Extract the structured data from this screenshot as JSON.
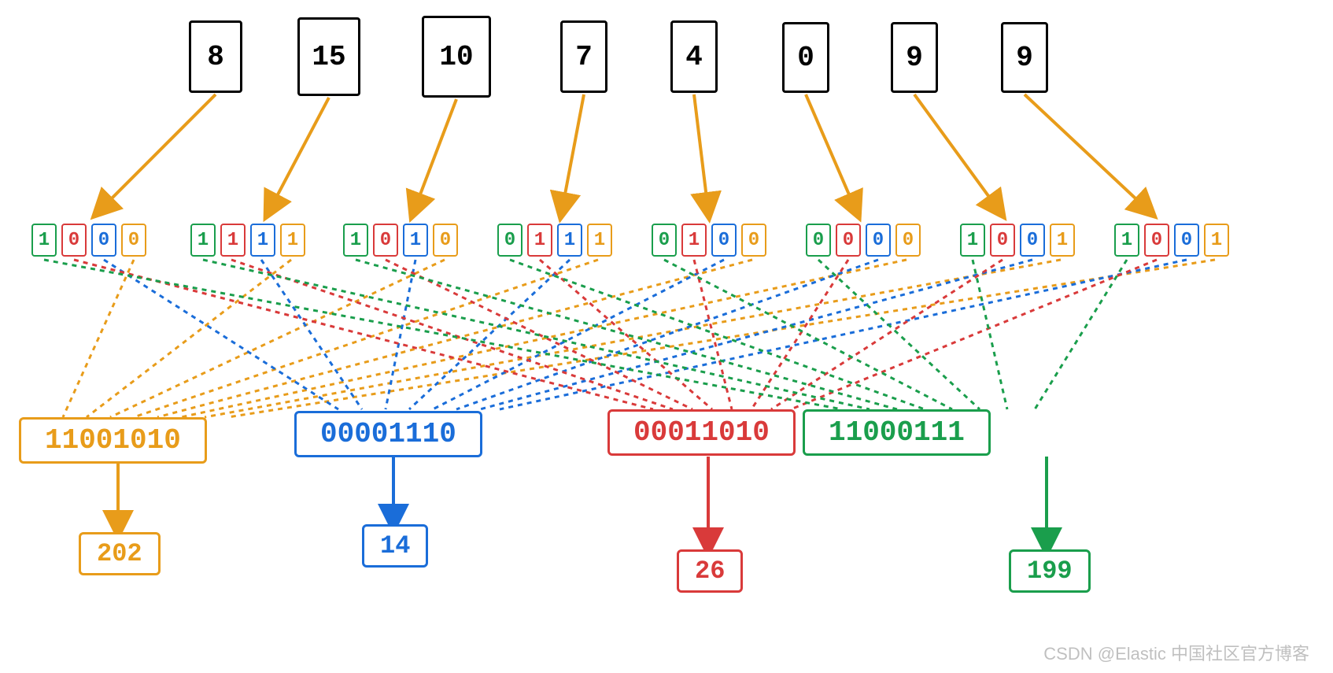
{
  "decimal_row": [
    "8",
    "15",
    "10",
    "7",
    "4",
    "0",
    "9",
    "9"
  ],
  "bit_rows": [
    [
      "1",
      "0",
      "0",
      "0"
    ],
    [
      "1",
      "1",
      "1",
      "1"
    ],
    [
      "1",
      "0",
      "1",
      "0"
    ],
    [
      "0",
      "1",
      "1",
      "1"
    ],
    [
      "0",
      "1",
      "0",
      "0"
    ],
    [
      "0",
      "0",
      "0",
      "0"
    ],
    [
      "1",
      "0",
      "0",
      "1"
    ],
    [
      "1",
      "0",
      "0",
      "1"
    ]
  ],
  "bit_colors": [
    "green",
    "red",
    "blue",
    "orange"
  ],
  "results": [
    {
      "binary": "11001010",
      "decimal": "202",
      "color": "orange"
    },
    {
      "binary": "00001110",
      "decimal": "14",
      "color": "blue"
    },
    {
      "binary": "00011010",
      "decimal": "26",
      "color": "red"
    },
    {
      "binary": "11000111",
      "decimal": "199",
      "color": "green"
    }
  ],
  "watermark": "CSDN @Elastic 中国社区官方博客",
  "colors": {
    "orange": "#e89c1a",
    "blue": "#1a6dd9",
    "red": "#d93a3a",
    "green": "#1a9e4c"
  }
}
